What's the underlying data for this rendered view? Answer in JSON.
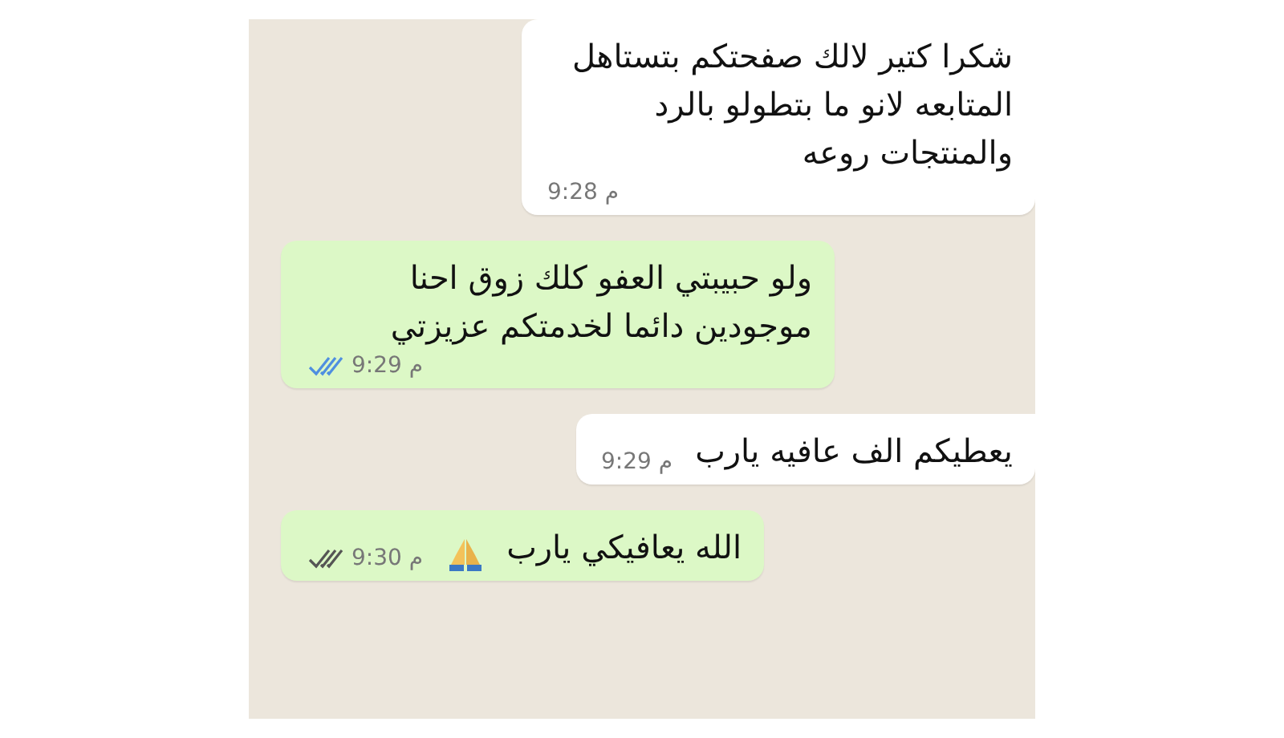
{
  "messages": [
    {
      "kind": "received",
      "text": "شكرا كتير لالك صفحتكم بتستاهل المتابعه لانو ما بتطولو بالرد والمنتجات روعه",
      "time": "9:28 م"
    },
    {
      "kind": "sent",
      "text": "ولو حبيبتي العفو كلك زوق احنا موجودين دائما لخدمتكم عزيزتي",
      "time": "9:29 م",
      "read": true
    },
    {
      "kind": "received",
      "text": "يعطيكم الف عافيه يارب",
      "time": "9:29 م"
    },
    {
      "kind": "sent",
      "text": "الله يعافيكي يارب",
      "time": "9:30 م",
      "read": false,
      "emoji": true
    }
  ]
}
